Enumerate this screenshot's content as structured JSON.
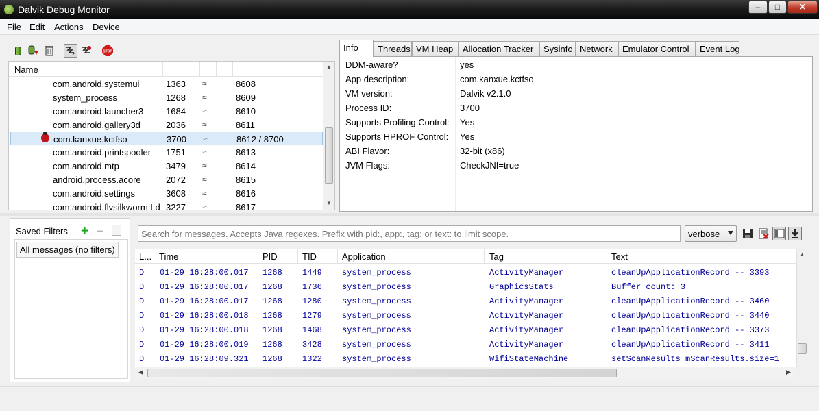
{
  "window": {
    "title": "Dalvik Debug Monitor"
  },
  "menu": [
    "File",
    "Edit",
    "Actions",
    "Device"
  ],
  "toolbar": {
    "icons": [
      "update-heap-icon",
      "dump-hprof-icon",
      "cause-gc-icon",
      "update-threads-icon",
      "start-method-profiling-icon",
      "stop-process-icon"
    ],
    "stop_label": "STOP"
  },
  "devices": {
    "header_name": "Name",
    "rows": [
      {
        "name": "com.android.systemui",
        "pid": "1363",
        "port": "8608",
        "selected": false,
        "debug": false
      },
      {
        "name": "system_process",
        "pid": "1268",
        "port": "8609",
        "selected": false,
        "debug": false
      },
      {
        "name": "com.android.launcher3",
        "pid": "1684",
        "port": "8610",
        "selected": false,
        "debug": false
      },
      {
        "name": "com.android.gallery3d",
        "pid": "2036",
        "port": "8611",
        "selected": false,
        "debug": false
      },
      {
        "name": "com.kanxue.kctfso",
        "pid": "3700",
        "port": "8612 / 8700",
        "selected": true,
        "debug": true
      },
      {
        "name": "com.android.printspooler",
        "pid": "1751",
        "port": "8613",
        "selected": false,
        "debug": false
      },
      {
        "name": "com.android.mtp",
        "pid": "3479",
        "port": "8614",
        "selected": false,
        "debug": false
      },
      {
        "name": "android.process.acore",
        "pid": "2072",
        "port": "8615",
        "selected": false,
        "debug": false
      },
      {
        "name": "com.android.settings",
        "pid": "3608",
        "port": "8616",
        "selected": false,
        "debug": false
      },
      {
        "name": "com.android.flysilkworm:Ld",
        "pid": "3227",
        "port": "8617",
        "selected": false,
        "debug": false
      }
    ]
  },
  "tabs": [
    "Info",
    "Threads",
    "VM Heap",
    "Allocation Tracker",
    "Sysinfo",
    "Network",
    "Emulator Control",
    "Event Log"
  ],
  "active_tab": "Info",
  "info": [
    {
      "key": "DDM-aware?",
      "value": "yes"
    },
    {
      "key": "App description:",
      "value": "com.kanxue.kctfso"
    },
    {
      "key": "VM version:",
      "value": "Dalvik v2.1.0"
    },
    {
      "key": "Process ID:",
      "value": "3700"
    },
    {
      "key": "Supports Profiling Control:",
      "value": "Yes"
    },
    {
      "key": "Supports HPROF Control:",
      "value": "Yes"
    },
    {
      "key": "ABI Flavor:",
      "value": "32-bit (x86)"
    },
    {
      "key": "JVM Flags:",
      "value": "CheckJNI=true"
    }
  ],
  "filters": {
    "title": "Saved Filters",
    "items": [
      "All messages (no filters)"
    ]
  },
  "logcat": {
    "search_placeholder": "Search for messages. Accepts Java regexes. Prefix with pid:, app:, tag: or text: to limit scope.",
    "level": "verbose",
    "columns": [
      "L...",
      "Time",
      "PID",
      "TID",
      "Application",
      "Tag",
      "Text"
    ],
    "rows": [
      {
        "level": "D",
        "time": "01-29 16:28:00.017",
        "pid": "1268",
        "tid": "1449",
        "app": "system_process",
        "tag": "ActivityManager",
        "text": "cleanUpApplicationRecord -- 3393"
      },
      {
        "level": "D",
        "time": "01-29 16:28:00.017",
        "pid": "1268",
        "tid": "1736",
        "app": "system_process",
        "tag": "GraphicsStats",
        "text": "Buffer count: 3"
      },
      {
        "level": "D",
        "time": "01-29 16:28:00.017",
        "pid": "1268",
        "tid": "1280",
        "app": "system_process",
        "tag": "ActivityManager",
        "text": "cleanUpApplicationRecord -- 3460"
      },
      {
        "level": "D",
        "time": "01-29 16:28:00.018",
        "pid": "1268",
        "tid": "1279",
        "app": "system_process",
        "tag": "ActivityManager",
        "text": "cleanUpApplicationRecord -- 3440"
      },
      {
        "level": "D",
        "time": "01-29 16:28:00.018",
        "pid": "1268",
        "tid": "1468",
        "app": "system_process",
        "tag": "ActivityManager",
        "text": "cleanUpApplicationRecord -- 3373"
      },
      {
        "level": "D",
        "time": "01-29 16:28:00.019",
        "pid": "1268",
        "tid": "3428",
        "app": "system_process",
        "tag": "ActivityManager",
        "text": "cleanUpApplicationRecord -- 3411"
      },
      {
        "level": "D",
        "time": "01-29 16:28:09.321",
        "pid": "1268",
        "tid": "1322",
        "app": "system_process",
        "tag": "WifiStateMachine",
        "text": "setScanResults mScanResults.size=1"
      }
    ]
  },
  "colors": {
    "log_text": "#00009a",
    "selected_row": "#dbeaf9",
    "add_filter": "#1ea51e",
    "stop": "#d11a1a"
  }
}
